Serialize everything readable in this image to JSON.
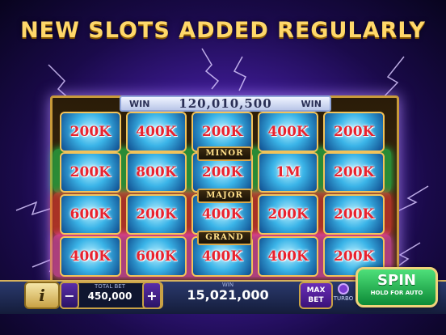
{
  "headline": "NEW SLOTS ADDED REGULARLY",
  "win_bar": {
    "left_label": "WIN",
    "amount": "120,010,500",
    "right_label": "WIN"
  },
  "reels": [
    [
      "200K",
      "400K",
      "200K",
      "400K",
      "200K"
    ],
    [
      "200K",
      "800K",
      "200K",
      "1M",
      "200K"
    ],
    [
      "600K",
      "200K",
      "400K",
      "200K",
      "200K"
    ],
    [
      "400K",
      "600K",
      "400K",
      "400K",
      "200K"
    ]
  ],
  "jackpot_labels": {
    "minor": "MINOR",
    "major": "MAJOR",
    "grand": "GRAND"
  },
  "colors": {
    "minor_band": "#21e05a",
    "major_band": "#ff3a3a",
    "grand_band": "#ff4fd8",
    "cell_value": "#e8232f"
  },
  "bottom_bar": {
    "info_label": "i",
    "minus_label": "−",
    "plus_label": "+",
    "total_bet_label": "TOTAL BET",
    "total_bet_value": "450,000",
    "win_label": "WIN",
    "win_value": "15,021,000",
    "max_bet_label": "MAX BET",
    "turbo_label": "TURBO",
    "spin_label": "SPIN",
    "spin_sub_label": "HOLD FOR AUTO"
  }
}
